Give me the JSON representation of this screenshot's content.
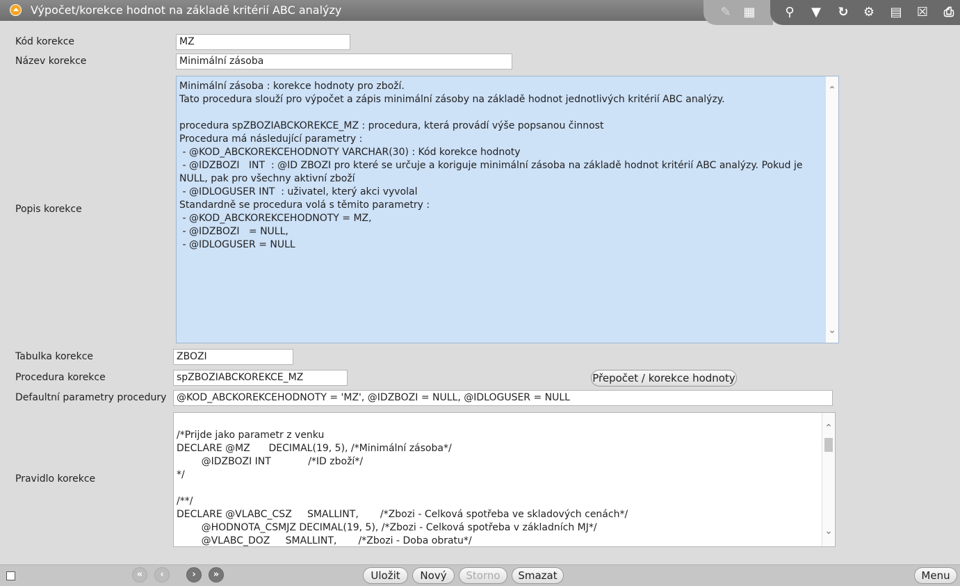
{
  "window": {
    "title": "Výpočet/korekce hodnot na základě kritérií ABC analýzy"
  },
  "toolbar": {
    "icons": [
      "edit-icon",
      "grid-icon",
      "search-icon",
      "filter-icon",
      "refresh-icon",
      "settings-user-icon",
      "document-icon",
      "close-icon",
      "print-icon"
    ]
  },
  "form": {
    "kod": {
      "label": "Kód korekce",
      "value": "MZ"
    },
    "nazev": {
      "label": "Název korekce",
      "value": "Minimální zásoba"
    },
    "popis": {
      "label": "Popis korekce",
      "value": "Minimální zásoba : korekce hodnoty pro zboží.\nTato procedura slouží pro výpočet a zápis minimální zásoby na základě hodnot jednotlivých kritérií ABC analýzy.\n\nprocedura spZBOZIABCKOREKCE_MZ : procedura, která provádí výše popsanou činnost\nProcedura má následující parametry :\n - @KOD_ABCKOREKCEHODNOTY VARCHAR(30) : Kód korekce hodnoty\n - @IDZBOZI   INT  : @ID ZBOZI pro které se určuje a koriguje minimální zásoba na základě hodnot kritérií ABC analýzy. Pokud je NULL, pak pro všechny aktivní zboží\n - @IDLOGUSER INT  : uživatel, který akci vyvolal\nStandardně se procedura volá s těmito parametry :\n - @KOD_ABCKOREKCEHODNOTY = MZ,\n - @IDZBOZI   = NULL,\n - @IDLOGUSER = NULL"
    },
    "tabulka": {
      "label": "Tabulka korekce",
      "value": "ZBOZI"
    },
    "procedura": {
      "label": "Procedura korekce",
      "value": "spZBOZIABCKOREKCE_MZ"
    },
    "recalc_button": "Přepočet / korekce hodnoty",
    "parametry": {
      "label": "Defaultní parametry procedury",
      "value": "@KOD_ABCKOREKCEHODNOTY = 'MZ', @IDZBOZI = NULL, @IDLOGUSER = NULL"
    },
    "pravidlo": {
      "label": "Pravidlo korekce",
      "value": "/*Prijde jako parametr z venku\nDECLARE @MZ      DECIMAL(19, 5), /*Minimální zásoba*/\n        @IDZBOZI INT            /*ID zboží*/\n*/\n\n/**/\nDECLARE @VLABC_CSZ     SMALLINT,       /*Zbozi - Celková spotřeba ve skladových cenách*/\n        @HODNOTA_CSMJZ DECIMAL(19, 5), /*Zbozi - Celková spotřeba v základních MJ*/\n        @VLABC_DOZ     SMALLINT,       /*Zbozi - Doba obratu*/"
    }
  },
  "footer": {
    "save": "Uložit",
    "new": "Nový",
    "cancel": "Storno",
    "delete": "Smazat",
    "menu": "Menu"
  }
}
